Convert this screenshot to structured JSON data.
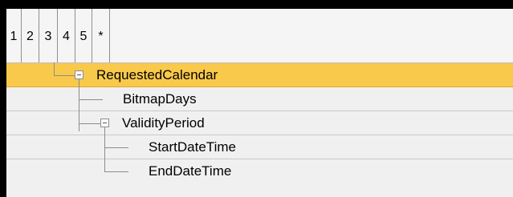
{
  "level_bar": {
    "tabs": [
      "1",
      "2",
      "3",
      "4",
      "5",
      "*"
    ]
  },
  "tree": {
    "rows": [
      {
        "label": "RequestedCalendar",
        "selected": true,
        "expandable": true
      },
      {
        "label": "BitmapDays",
        "selected": false,
        "expandable": false
      },
      {
        "label": "ValidityPeriod",
        "selected": false,
        "expandable": true
      },
      {
        "label": "StartDateTime",
        "selected": false,
        "expandable": false
      },
      {
        "label": "EndDateTime",
        "selected": false,
        "expandable": false
      }
    ]
  },
  "colors": {
    "selection": "#f9c94b",
    "row_background": "#f0f0f0",
    "frame": "#000000"
  },
  "icons": {
    "collapse": "collapse-minus-icon"
  }
}
